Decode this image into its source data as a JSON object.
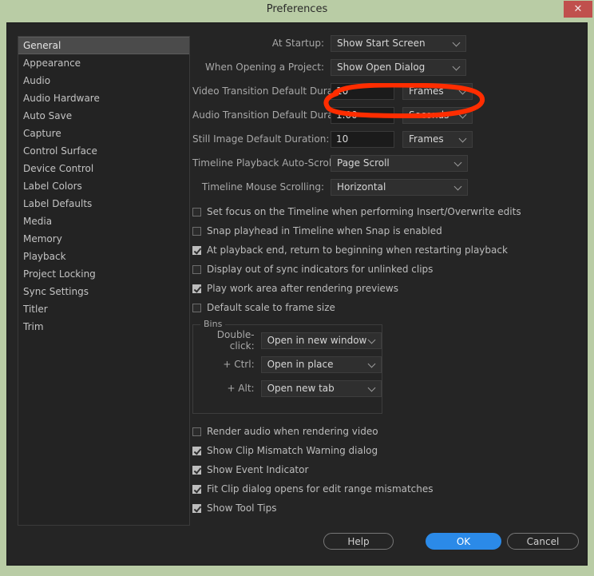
{
  "window": {
    "title": "Preferences",
    "close_label": "✕"
  },
  "colors": {
    "titlebar": "#b9cca5",
    "close_button": "#c0504d",
    "dialog_bg": "#252525",
    "accent_primary": "#2b8ae8",
    "annotation": "#ff2d00"
  },
  "sidebar": {
    "items": [
      {
        "label": "General",
        "selected": true
      },
      {
        "label": "Appearance",
        "selected": false
      },
      {
        "label": "Audio",
        "selected": false
      },
      {
        "label": "Audio Hardware",
        "selected": false
      },
      {
        "label": "Auto Save",
        "selected": false
      },
      {
        "label": "Capture",
        "selected": false
      },
      {
        "label": "Control Surface",
        "selected": false
      },
      {
        "label": "Device Control",
        "selected": false
      },
      {
        "label": "Label Colors",
        "selected": false
      },
      {
        "label": "Label Defaults",
        "selected": false
      },
      {
        "label": "Media",
        "selected": false
      },
      {
        "label": "Memory",
        "selected": false
      },
      {
        "label": "Playback",
        "selected": false
      },
      {
        "label": "Project Locking",
        "selected": false
      },
      {
        "label": "Sync Settings",
        "selected": false
      },
      {
        "label": "Titler",
        "selected": false
      },
      {
        "label": "Trim",
        "selected": false
      }
    ]
  },
  "general": {
    "at_startup": {
      "label": "At Startup:",
      "value": "Show Start Screen"
    },
    "when_opening_project": {
      "label": "When Opening a Project:",
      "value": "Show Open Dialog"
    },
    "video_transition": {
      "label": "Video Transition Default Duration:",
      "value": "10",
      "unit": "Frames",
      "highlighted": true
    },
    "audio_transition": {
      "label": "Audio Transition Default Duration:",
      "value": "1.00",
      "unit": "Seconds"
    },
    "still_image": {
      "label": "Still Image Default Duration:",
      "value": "10",
      "unit": "Frames"
    },
    "timeline_auto_scroll": {
      "label": "Timeline Playback Auto-Scrolling:",
      "value": "Page Scroll"
    },
    "timeline_mouse_scroll": {
      "label": "Timeline Mouse Scrolling:",
      "value": "Horizontal"
    },
    "checkboxes_upper": [
      {
        "label": "Set focus on the Timeline when performing Insert/Overwrite edits",
        "checked": false
      },
      {
        "label": "Snap playhead in Timeline when Snap is enabled",
        "checked": false
      },
      {
        "label": "At playback end, return to beginning when restarting playback",
        "checked": true
      },
      {
        "label": "Display out of sync indicators for unlinked clips",
        "checked": false
      },
      {
        "label": "Play work area after rendering previews",
        "checked": true
      },
      {
        "label": "Default scale to frame size",
        "checked": false
      }
    ],
    "bins": {
      "legend": "Bins",
      "rows": [
        {
          "label": "Double-click:",
          "value": "Open in new window"
        },
        {
          "label": "+ Ctrl:",
          "value": "Open in place"
        },
        {
          "label": "+ Alt:",
          "value": "Open new tab"
        }
      ]
    },
    "checkboxes_lower": [
      {
        "label": "Render audio when rendering video",
        "checked": false
      },
      {
        "label": "Show Clip Mismatch Warning dialog",
        "checked": true
      },
      {
        "label": "Show Event Indicator",
        "checked": true
      },
      {
        "label": "Fit Clip dialog opens for edit range mismatches",
        "checked": true
      },
      {
        "label": "Show Tool Tips",
        "checked": true
      }
    ]
  },
  "footer": {
    "help_label": "Help",
    "ok_label": "OK",
    "cancel_label": "Cancel"
  }
}
